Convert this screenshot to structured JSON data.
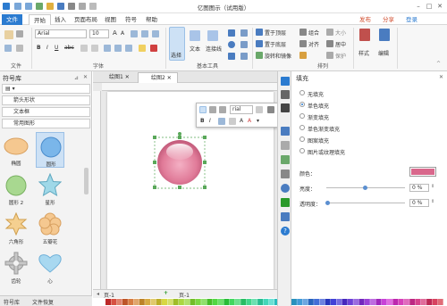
{
  "window": {
    "title": "亿图图示（试用版）"
  },
  "menu": {
    "file": "文件",
    "tabs": [
      "开始",
      "插入",
      "页面布局",
      "视图",
      "符号",
      "帮助"
    ],
    "publish": "发布",
    "share": "分享",
    "login": "登录"
  },
  "ribbon": {
    "font_name": "Arial",
    "font_size": "10",
    "group_file": "文件",
    "group_font": "字体",
    "group_basic": "基本工具",
    "group_arrange": "排列",
    "select_label": "选择",
    "text_label": "文本",
    "connector_label": "连接线",
    "bring_front": "置于顶层",
    "send_back": "置于底层",
    "rotate": "旋转和镜像",
    "group": "组合",
    "align": "对齐",
    "center": "居中",
    "size": "大小",
    "distribute": "分布",
    "protect": "保护",
    "style_label": "样式",
    "edit_label": "编辑"
  },
  "library": {
    "title": "符号库",
    "categories": [
      "箭头形状",
      "文本框",
      "常用图形"
    ],
    "shapes": [
      {
        "label": "椭圆",
        "icon": "ellipse-shape-icon"
      },
      {
        "label": "圆形",
        "icon": "circle-shape-icon"
      },
      {
        "label": "圆形 2",
        "icon": "circle2-shape-icon"
      },
      {
        "label": "星形",
        "icon": "star-shape-icon"
      },
      {
        "label": "六角形",
        "icon": "hexagram-shape-icon"
      },
      {
        "label": "五瓣花",
        "icon": "flower-shape-icon"
      },
      {
        "label": "齿轮",
        "icon": "gear-shape-icon"
      },
      {
        "label": "心",
        "icon": "heart-shape-icon"
      }
    ],
    "bottom_tabs": [
      "符号库",
      "文件恢复"
    ]
  },
  "doc_tabs": [
    "绘图1",
    "绘图2"
  ],
  "float_toolbar": {
    "font": "rial"
  },
  "page_bar": {
    "page_label": "页-1",
    "page_tab": "页-1"
  },
  "fill_panel": {
    "title": "填充",
    "options": [
      "无填充",
      "单色填充",
      "渐变填充",
      "单色渐变填充",
      "图案填充",
      "图片或纹理填充"
    ],
    "selected": 1,
    "color_label": "颜色：",
    "brightness_label": "亮度：",
    "transparency_label": "透明度：",
    "brightness_value": "0 %",
    "transparency_value": "0 %",
    "fill_color": "#d9688c"
  },
  "colors": {
    "accent": "#2b7bd0",
    "ball": "#e07a98"
  }
}
